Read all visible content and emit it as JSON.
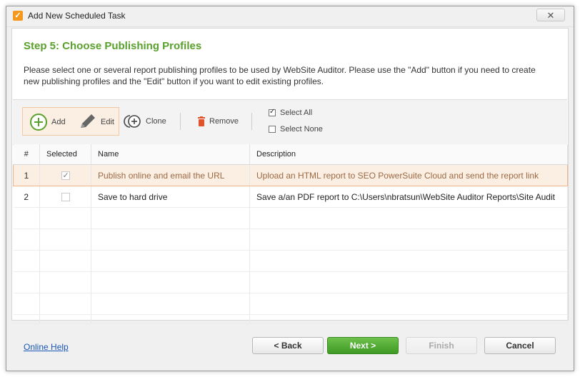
{
  "window": {
    "title": "Add New Scheduled Task",
    "close_glyph": "✕"
  },
  "step": {
    "title": "Step 5: Choose Publishing Profiles",
    "description_line1": "Please select one or several report publishing profiles to be used by WebSite Auditor. Please use the \"Add\" button if you need to create",
    "description_line2": "new publishing profiles and the \"Edit\" button if you want to edit existing profiles."
  },
  "toolbar": {
    "add_label": "Add",
    "edit_label": "Edit",
    "clone_label": "Clone",
    "remove_label": "Remove",
    "select_all_label": "Select All",
    "select_none_label": "Select None",
    "select_all_checked": true,
    "select_none_checked": false
  },
  "table": {
    "columns": {
      "num": "#",
      "selected": "Selected",
      "name": "Name",
      "description": "Description"
    },
    "rows": [
      {
        "num": "1",
        "selected": true,
        "name": "Publish online and email the URL",
        "description": "Upload an HTML report to SEO PowerSuite Cloud and send the report link"
      },
      {
        "num": "2",
        "selected": false,
        "name": "Save to hard drive",
        "description": "Save a/an PDF report to C:\\Users\\nbratsun\\WebSite Auditor Reports\\Site Audit"
      }
    ]
  },
  "footer": {
    "help_label": "Online Help",
    "back_label": "< Back",
    "next_label": "Next >",
    "finish_label": "Finish",
    "cancel_label": "Cancel"
  },
  "colors": {
    "accent_green": "#5aa02c",
    "highlight": "#fbeee2",
    "link": "#1a56b8",
    "remove_red": "#e0532c"
  }
}
